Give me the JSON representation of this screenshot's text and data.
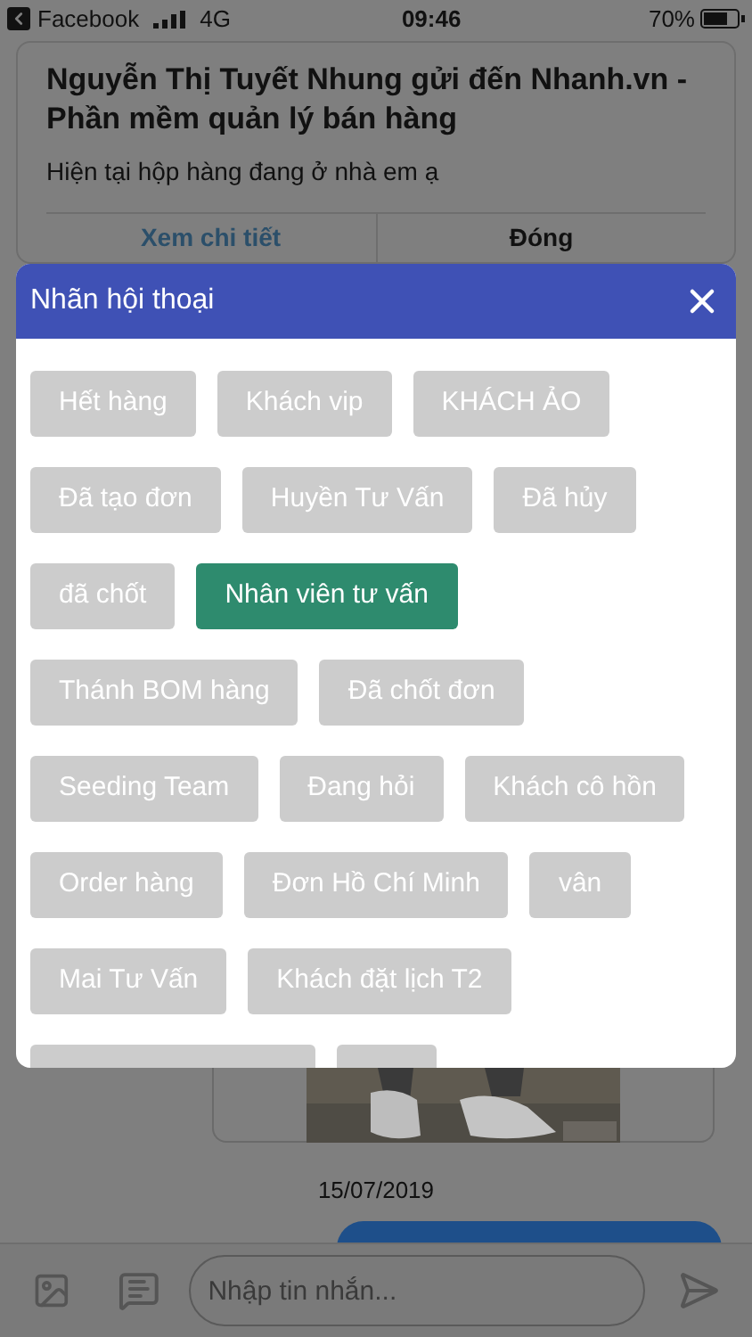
{
  "status_bar": {
    "back_app": "Facebook",
    "network": "4G",
    "time": "09:46",
    "battery": "70%"
  },
  "notification": {
    "title": "Nguyễn Thị Tuyết Nhung gửi đến Nhanh.vn - Phần mềm quản lý bán hàng",
    "message": "Hiện tại hộp hàng đang ở nhà em ạ",
    "actions": [
      {
        "label": "Xem chi tiết",
        "kind": "link"
      },
      {
        "label": "Đóng",
        "kind": "close"
      }
    ]
  },
  "dialog": {
    "title": "Nhãn hội thoại",
    "tags": [
      {
        "label": "Hết hàng",
        "selected": false
      },
      {
        "label": "Khách vip",
        "selected": false
      },
      {
        "label": "KHÁCH ẢO",
        "selected": false
      },
      {
        "label": "Đã tạo đơn",
        "selected": false
      },
      {
        "label": "Huyền Tư Vấn",
        "selected": false
      },
      {
        "label": "Đã hủy",
        "selected": false
      },
      {
        "label": "đã chốt",
        "selected": false
      },
      {
        "label": "Nhân viên tư vấn",
        "selected": true
      },
      {
        "label": "Thánh BOM hàng",
        "selected": false
      },
      {
        "label": "Đã chốt đơn",
        "selected": false
      },
      {
        "label": "Seeding Team",
        "selected": false
      },
      {
        "label": "Đang hỏi",
        "selected": false
      },
      {
        "label": "Khách cô hồn",
        "selected": false
      },
      {
        "label": "Order hàng",
        "selected": false
      },
      {
        "label": "Đơn Hồ Chí Minh",
        "selected": false
      },
      {
        "label": "vân",
        "selected": false
      },
      {
        "label": "Mai Tư Vấn",
        "selected": false
      },
      {
        "label": "Khách đặt lịch T2",
        "selected": false
      }
    ]
  },
  "chat": {
    "date": "15/07/2019"
  },
  "composer": {
    "placeholder": "Nhập tin nhắn..."
  }
}
